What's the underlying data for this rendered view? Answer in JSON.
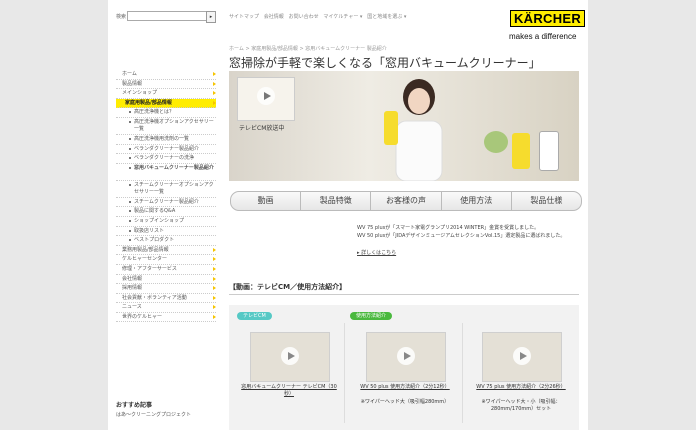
{
  "search": {
    "label": "検索",
    "button": "▸"
  },
  "top_nav": [
    "サイトマップ",
    "会社情報",
    "お問い合わせ",
    "マイケルチャー",
    "国と地域を選ぶ"
  ],
  "brand": {
    "name": "KÄRCHER",
    "tagline": "makes a difference",
    "yellow": "#ffed00"
  },
  "breadcrumb": "ホーム > 家庭用製品/部品情報 > 窓用バキュームクリーナー 製品紹介",
  "page_title": "窓掃除が手軽で楽しくなる「窓用バキュームクリーナー」",
  "hero": {
    "thumb_caption": "テレビCM放送中"
  },
  "left_nav": [
    {
      "label": "ホーム",
      "level": 1
    },
    {
      "label": "製品情報",
      "level": 1
    },
    {
      "label": "メインショップ",
      "level": 1
    },
    {
      "label": "家庭用製品/部品情報",
      "level": 1,
      "active": true
    },
    {
      "label": "高圧洗浄機とは？",
      "level": 2
    },
    {
      "label": "高圧洗浄機オプションアクセサリー一覧",
      "level": 2,
      "tall": true
    },
    {
      "label": "高圧洗浄機用洗剤の一覧",
      "level": 2
    },
    {
      "label": "ベランダクリーナー製品紹介",
      "level": 2
    },
    {
      "label": "ベランダクリーナーの洗浄",
      "level": 2
    },
    {
      "label": "窓用バキュームクリーナー製品紹介",
      "level": 2,
      "tall": true,
      "bold": true
    },
    {
      "label": "スチームクリーナーオプションアクセサリー一覧",
      "level": 2,
      "tall": true
    },
    {
      "label": "スチームクリーナー製品紹介",
      "level": 2
    },
    {
      "label": "製品に関するQ&A",
      "level": 2
    },
    {
      "label": "ショップインショップ",
      "level": 2
    },
    {
      "label": "取扱店リスト",
      "level": 2
    },
    {
      "label": "ベストプロダクト",
      "level": 2
    },
    {
      "label": "業務用製品/部品情報",
      "level": 1
    },
    {
      "label": "ケルヒャーセンター",
      "level": 1
    },
    {
      "label": "修理・アフターサービス",
      "level": 1
    },
    {
      "label": "会社情報",
      "level": 1
    },
    {
      "label": "採用情報",
      "level": 1
    },
    {
      "label": "社会貢献・ボランティア活動",
      "level": 1
    },
    {
      "label": "ニュース",
      "level": 1
    },
    {
      "label": "世界のケルヒャー",
      "level": 1
    }
  ],
  "recommend": {
    "title": "おすすめ記事",
    "item": "はあ〜クリーニングプロジェクト"
  },
  "tabs": [
    "動画",
    "製品特徴",
    "お客様の声",
    "使用方法",
    "製品仕様"
  ],
  "news": [
    "WV 75 plusが「スマート家電グランプリ2014 WINTER」金賞を受賞しました。",
    "WV 50 plusが「JIDAデザインミュージアムセレクションVol.15」選定製品に選ばれました。"
  ],
  "news_more": "詳しくはこちら",
  "video_section": {
    "title": "【動画：テレビCM／使用方法紹介】",
    "groups": [
      {
        "pill": "テレビCM",
        "pill_color": "#56c9c5"
      },
      {
        "pill": "使用方法紹介",
        "pill_color": "#4ab93e"
      }
    ],
    "videos": [
      {
        "caption": "窓用バキュームクリーナー テレビCM（30秒）",
        "sub": ""
      },
      {
        "caption": "WV 50 plus 使用方法紹介（2分12秒）",
        "sub": "※ワイパーへッド大（吸引幅280mm）"
      },
      {
        "caption": "WV 75 plus 使用方法紹介（2分26秒）",
        "sub": "※ワイパーへッド大・小（吸引幅：280mm/170mm）セット"
      }
    ]
  }
}
